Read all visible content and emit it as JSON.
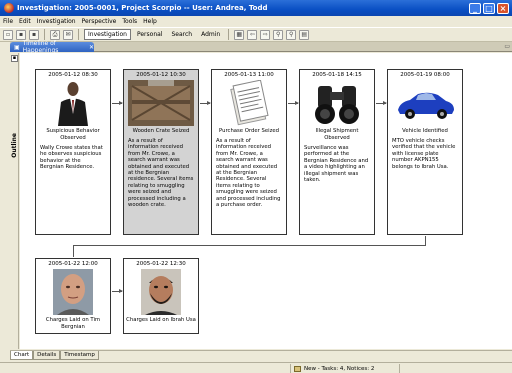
{
  "window": {
    "title": "Investigation: 2005-0001, Project Scorpio -- User: Andrea, Todd"
  },
  "menu": [
    "File",
    "Edit",
    "Investigation",
    "Perspective",
    "Tools",
    "Help"
  ],
  "toolbar": {
    "perspectives": [
      {
        "label": "Investigation",
        "active": true
      },
      {
        "label": "Personal",
        "active": false
      },
      {
        "label": "Search",
        "active": false
      },
      {
        "label": "Admin",
        "active": false
      }
    ]
  },
  "editor_tab": {
    "label": "Timeline of Happenings"
  },
  "outline": {
    "label": "Outline"
  },
  "events": [
    {
      "date": "2005-01-12 08:30",
      "caption": "Suspicious Behavior Observed",
      "description": "Wally Crowe states that he observes suspicious behavior at the Bergnian Residence.",
      "image": "businessman-silhouette",
      "selected": false
    },
    {
      "date": "2005-01-12 10:30",
      "caption": "Wooden Crate Seized",
      "description": "As a result of information received from Mr. Crowe, a search warrant was obtained and executed at the Bergnian residence. Several items relating to smuggling were seized and processed including a wooden crate.",
      "image": "wooden-crate-photo",
      "selected": true
    },
    {
      "date": "2005-01-13 11:00",
      "caption": "Purchase Order Seized",
      "description": "As a result of information received from Mr. Crowe, a search warrant was obtained and executed at the Bergnian Residence. Several items relating to smuggling were seized and processed including a purchase order.",
      "image": "document-papers",
      "selected": false
    },
    {
      "date": "2005-01-18 14:15",
      "caption": "Illegal Shipment Observed",
      "description": "Surveillance was performed at the Bergnian Residence and a video highlighting an illegal shipment was taken.",
      "image": "binoculars",
      "selected": false
    },
    {
      "date": "2005-01-19 08:00",
      "caption": "Vehicle Identified",
      "description": "MTO vehicle checks verified that the vehicle with license plate number AKPN155 belongs to Ibrah Usa.",
      "image": "blue-car",
      "selected": false
    },
    {
      "date": "2005-01-22 12:00",
      "caption": "Charges Laid on Tim Bergnian",
      "description": "",
      "image": "mugshot-bald-man",
      "selected": false
    },
    {
      "date": "2005-01-22 12:30",
      "caption": "Charges Laid on Ibrah Usa",
      "description": "",
      "image": "mugshot-bearded-man",
      "selected": false
    }
  ],
  "bottom_tabs": [
    {
      "label": "Chart",
      "active": true
    },
    {
      "label": "Details",
      "active": false
    },
    {
      "label": "Timestamp",
      "active": false
    }
  ],
  "status": {
    "text": "New - Tasks: 4, Notices: 2"
  },
  "colors": {
    "titlebar": "#0a4fc4",
    "selected_card": "#d3d3d3",
    "car": "#1d3fbf"
  }
}
